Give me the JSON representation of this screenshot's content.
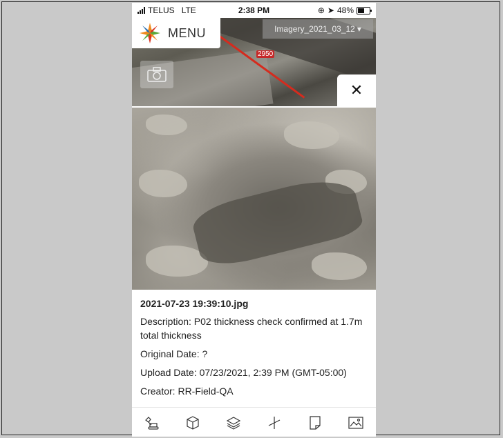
{
  "status_bar": {
    "carrier": "TELUS",
    "network": "LTE",
    "time": "2:38 PM",
    "battery": "48%"
  },
  "map": {
    "menu_label": "MENU",
    "imagery_select": "Imagery_2021_03_12",
    "road_label": "2950",
    "close_symbol": "✕"
  },
  "photo_details": {
    "filename": "2021-07-23 19:39:10.jpg",
    "description": "Description: P02 thickness check confirmed at 1.7m total thickness",
    "original_date": "Original Date: ?",
    "upload_date": "Upload Date: 07/23/2021, 2:39 PM (GMT-05:00)",
    "creator": "Creator: RR-Field-QA"
  },
  "toolbar": {
    "icons": [
      "excavator-icon",
      "cube-icon",
      "layers-icon",
      "measure-icon",
      "document-icon",
      "image-icon"
    ]
  },
  "colors": {
    "road": "#d52b1e",
    "logo_orange": "#f08a1c",
    "logo_green": "#5aa83c",
    "logo_red": "#d9341f",
    "logo_blue": "#2a6fb0"
  }
}
